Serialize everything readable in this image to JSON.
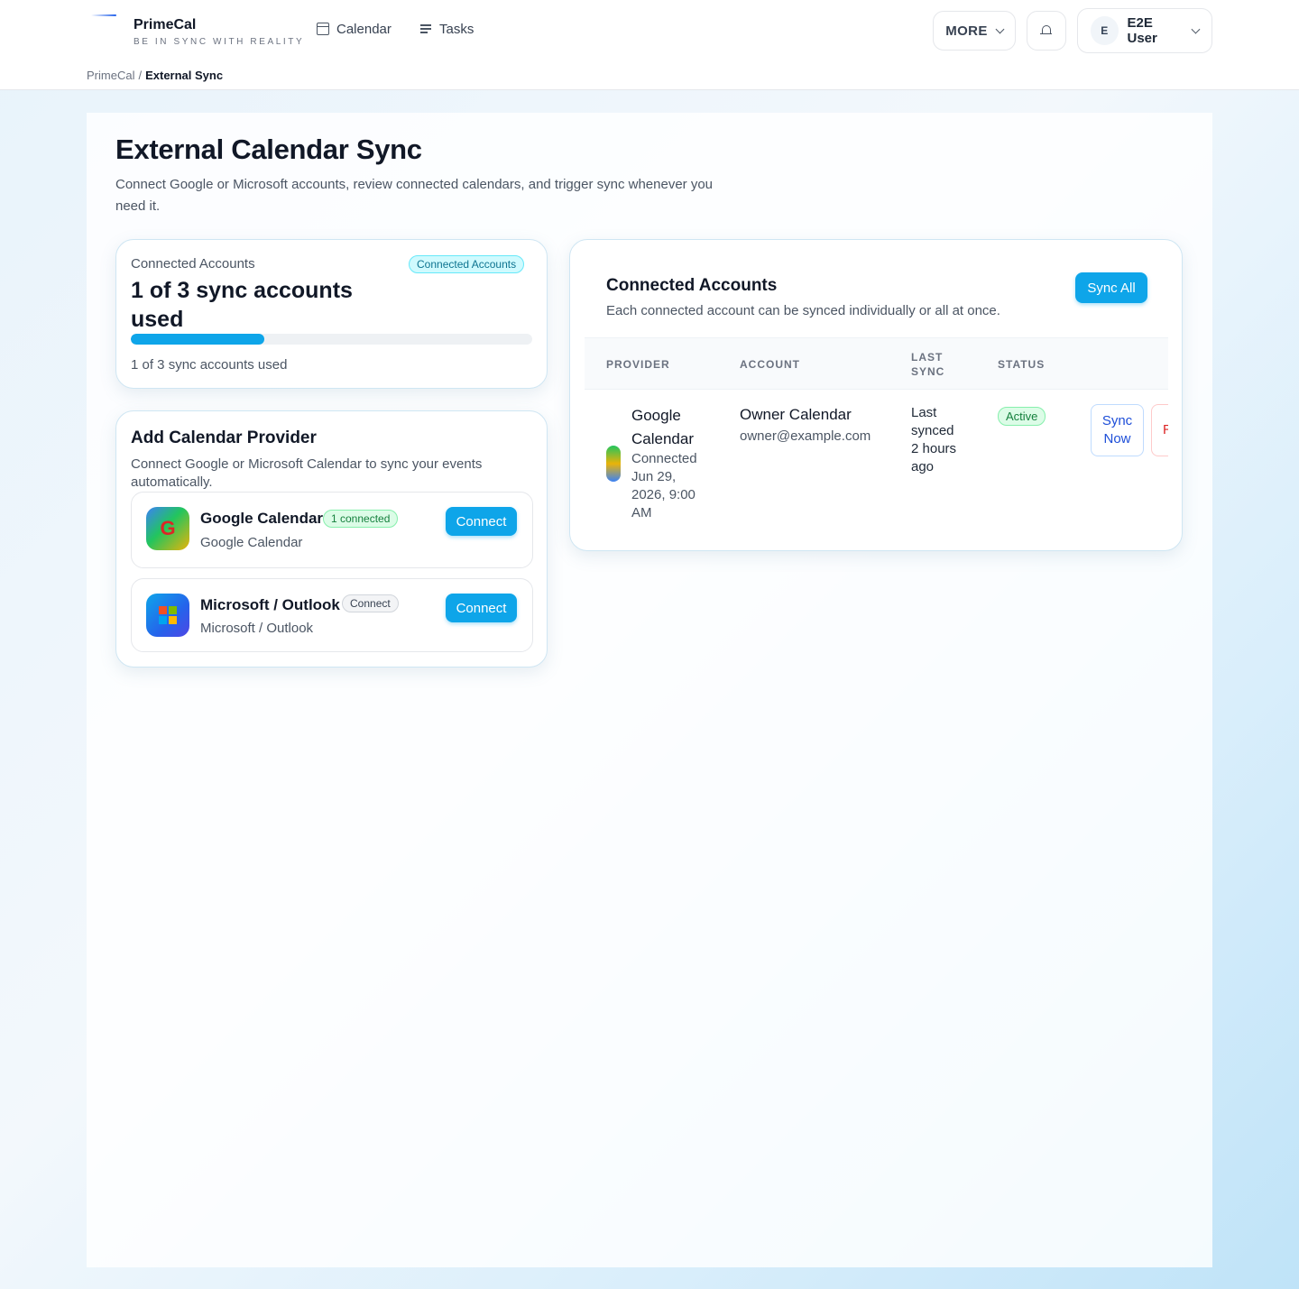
{
  "app": {
    "name": "PrimeCal",
    "tagline": "BE IN SYNC WITH REALITY"
  },
  "nav": {
    "items": [
      {
        "label": "Calendar",
        "icon": "calendar-icon"
      },
      {
        "label": "Tasks",
        "icon": "list-icon"
      }
    ],
    "more_label": "MORE",
    "notifications_icon": "bell-icon",
    "user": {
      "initial": "E",
      "name": "E2E User"
    }
  },
  "breadcrumb": {
    "root": "PrimeCal",
    "separator": "/",
    "current": "External Sync"
  },
  "page": {
    "title": "External Calendar Sync",
    "description": "Connect Google or Microsoft accounts, review connected calendars, and trigger sync whenever you need it."
  },
  "usage": {
    "label": "Connected Accounts",
    "badge": "Connected Accounts",
    "headline": "1 of 3 sync accounts used",
    "caption": "1 of 3 sync accounts used",
    "used": 1,
    "limit": 3
  },
  "providers": {
    "title": "Add Calendar Provider",
    "description": "Connect Google or Microsoft Calendar to sync your events automatically.",
    "items": [
      {
        "name": "Google Calendar",
        "badge": "1 connected",
        "subtitle": "Google Calendar",
        "button": "Connect",
        "icon_letter": "G"
      },
      {
        "name": "Microsoft / Outlook",
        "badge": "Connect",
        "subtitle": "Microsoft / Outlook",
        "button": "Connect"
      }
    ]
  },
  "accounts": {
    "title": "Connected Accounts",
    "description": "Each connected account can be synced individually or all at once.",
    "sync_all_label": "Sync All",
    "columns": [
      "PROVIDER",
      "ACCOUNT",
      "LAST SYNC",
      "STATUS"
    ],
    "rows": [
      {
        "provider": "Google Calendar",
        "connected": "Connected Jun 29, 2026, 9:00 AM",
        "account_name": "Owner Calendar",
        "account_email": "owner@example.com",
        "last_sync": "Last synced 2 hours ago",
        "status": "Active",
        "sync_now_label": "Sync Now",
        "remove_label": "R"
      }
    ]
  },
  "colors": {
    "accent": "#0ea5e9",
    "active_green": "#15803d",
    "danger": "#dc2626"
  }
}
